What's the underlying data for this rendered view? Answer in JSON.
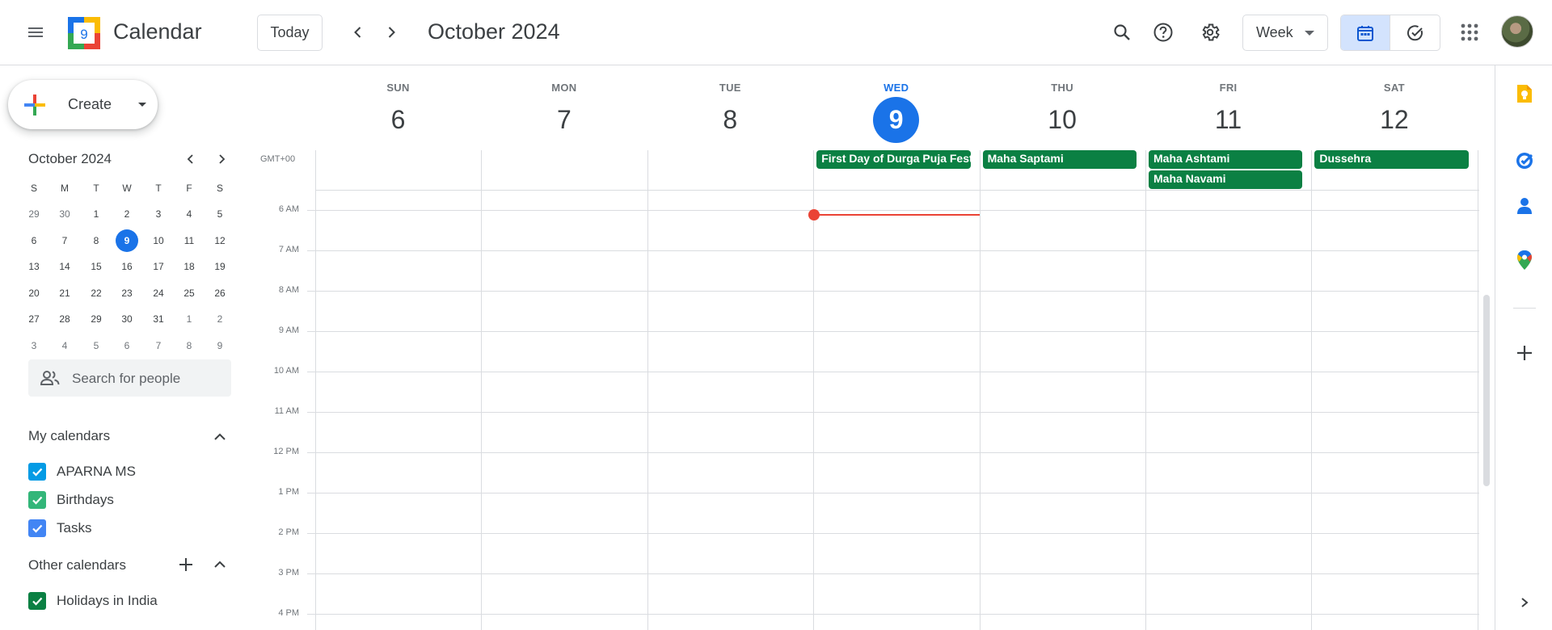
{
  "header": {
    "app_name": "Calendar",
    "logo_day": "9",
    "today_label": "Today",
    "current_period": "October 2024",
    "view_mode": "Week"
  },
  "sidebar": {
    "create_label": "Create",
    "mini_calendar": {
      "month_label": "October 2024",
      "weekday_headers": [
        "S",
        "M",
        "T",
        "W",
        "T",
        "F",
        "S"
      ],
      "weeks": [
        [
          "29",
          "30",
          "1",
          "2",
          "3",
          "4",
          "5"
        ],
        [
          "6",
          "7",
          "8",
          "9",
          "10",
          "11",
          "12"
        ],
        [
          "13",
          "14",
          "15",
          "16",
          "17",
          "18",
          "19"
        ],
        [
          "20",
          "21",
          "22",
          "23",
          "24",
          "25",
          "26"
        ],
        [
          "27",
          "28",
          "29",
          "30",
          "31",
          "1",
          "2"
        ],
        [
          "3",
          "4",
          "5",
          "6",
          "7",
          "8",
          "9"
        ]
      ],
      "today": "9"
    },
    "people_search_placeholder": "Search for people",
    "my_calendars": {
      "title": "My calendars",
      "items": [
        {
          "label": "APARNA MS",
          "color": "#039be5",
          "checked": true
        },
        {
          "label": "Birthdays",
          "color": "#33b679",
          "checked": true
        },
        {
          "label": "Tasks",
          "color": "#4285f4",
          "checked": true
        }
      ]
    },
    "other_calendars": {
      "title": "Other calendars",
      "items": [
        {
          "label": "Holidays in India",
          "color": "#0b8043",
          "checked": true
        }
      ]
    }
  },
  "week": {
    "timezone_label": "GMT+00",
    "days": [
      {
        "dow": "SUN",
        "date": "6",
        "today": false
      },
      {
        "dow": "MON",
        "date": "7",
        "today": false
      },
      {
        "dow": "TUE",
        "date": "8",
        "today": false
      },
      {
        "dow": "WED",
        "date": "9",
        "today": true
      },
      {
        "dow": "THU",
        "date": "10",
        "today": false
      },
      {
        "dow": "FRI",
        "date": "11",
        "today": false
      },
      {
        "dow": "SAT",
        "date": "12",
        "today": false
      }
    ],
    "all_day_events": [
      {
        "title": "First Day of Durga Puja Festivities",
        "day": 3,
        "row": 0,
        "color": "#0b8043"
      },
      {
        "title": "Maha Saptami",
        "day": 4,
        "row": 0,
        "color": "#0b8043"
      },
      {
        "title": "Maha Ashtami",
        "day": 5,
        "row": 0,
        "color": "#0b8043"
      },
      {
        "title": "Maha Navami",
        "day": 5,
        "row": 1,
        "color": "#0b8043"
      },
      {
        "title": "Dussehra",
        "day": 6,
        "row": 0,
        "color": "#0b8043"
      }
    ],
    "hour_labels": [
      "6 AM",
      "7 AM",
      "8 AM",
      "9 AM",
      "10 AM",
      "11 AM",
      "12 PM",
      "1 PM",
      "2 PM",
      "3 PM",
      "4 PM"
    ]
  },
  "colors": {
    "accent": "#1a73e8",
    "now_indicator": "#ea4335",
    "holiday": "#0b8043"
  }
}
